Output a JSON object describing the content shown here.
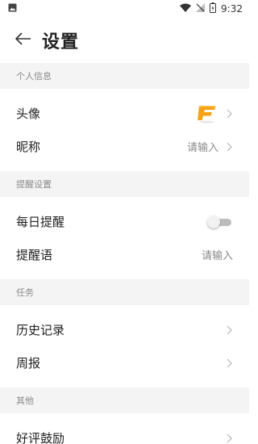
{
  "status_bar": {
    "time": "9:32",
    "icons": [
      "image-icon",
      "wifi-icon",
      "no-signal-icon",
      "battery-icon"
    ]
  },
  "header": {
    "title": "设置",
    "back_icon": "arrow-left-icon"
  },
  "sections": [
    {
      "title": "个人信息",
      "rows": [
        {
          "label": "头像",
          "value": "",
          "trailing": "avatar-chevron"
        },
        {
          "label": "昵称",
          "value": "请输入",
          "trailing": "chevron"
        }
      ]
    },
    {
      "title": "提醒设置",
      "rows": [
        {
          "label": "每日提醒",
          "value": "",
          "trailing": "toggle",
          "toggle_on": false
        },
        {
          "label": "提醒语",
          "value": "请输入",
          "trailing": "none"
        }
      ]
    },
    {
      "title": "任务",
      "rows": [
        {
          "label": "历史记录",
          "value": "",
          "trailing": "chevron"
        },
        {
          "label": "周报",
          "value": "",
          "trailing": "chevron"
        }
      ]
    },
    {
      "title": "其他",
      "rows": [
        {
          "label": "好评鼓励",
          "value": "",
          "trailing": "chevron"
        }
      ]
    }
  ],
  "colors": {
    "section_bg": "#f4f4f4",
    "secondary_text": "#8a8a8a",
    "logo_orange": "#f5a314"
  }
}
